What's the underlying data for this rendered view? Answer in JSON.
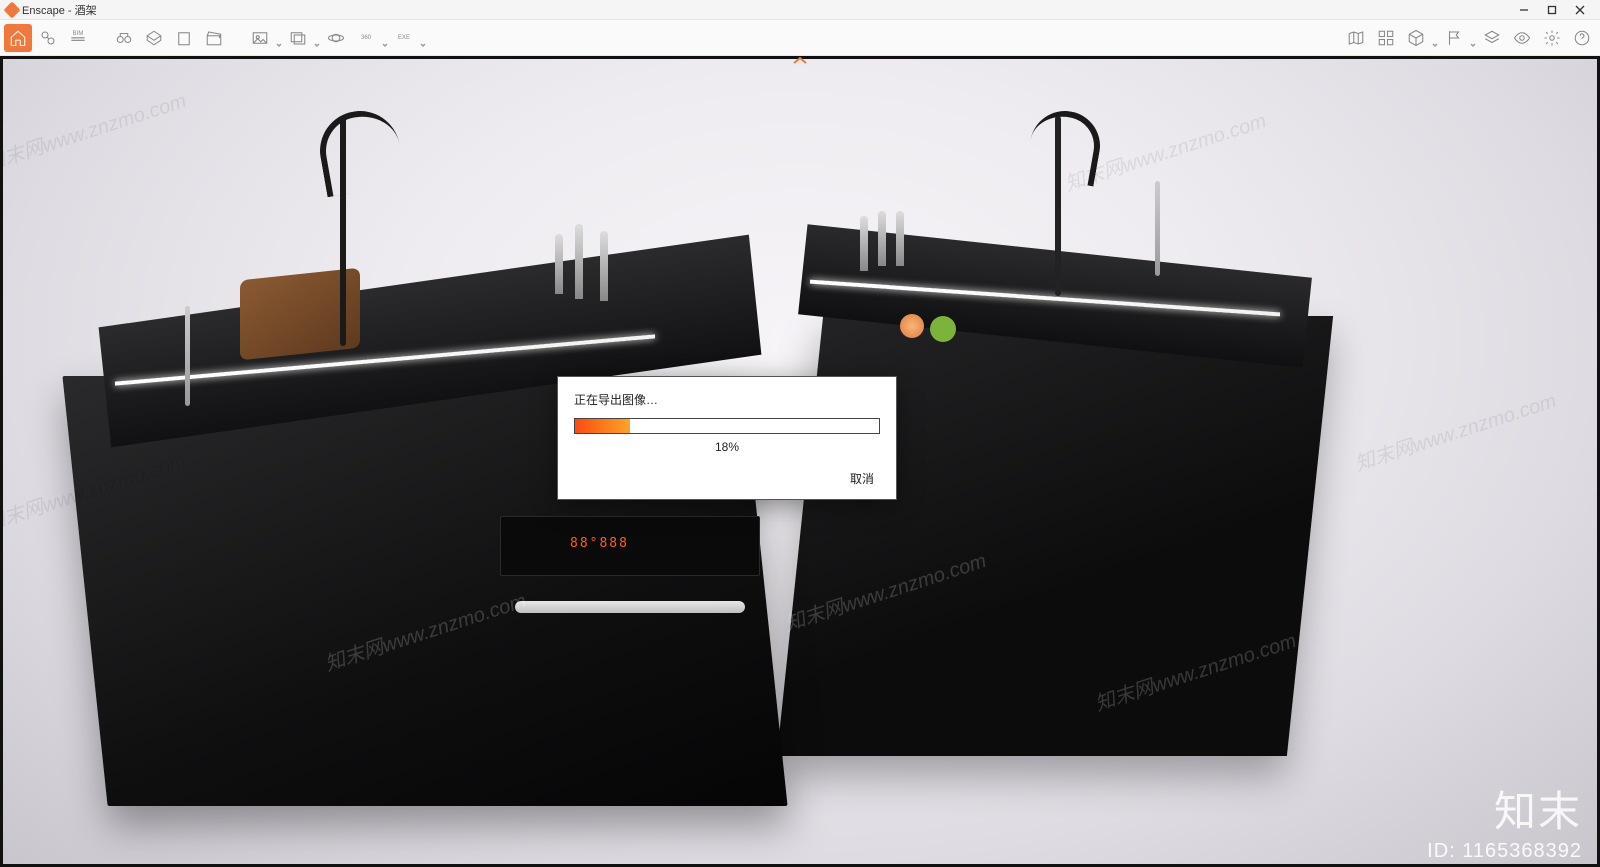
{
  "window": {
    "app_name": "Enscape",
    "document_name": "酒架",
    "title_separator": " - "
  },
  "toolbar": {
    "left_icons": [
      "home-icon",
      "link-icon",
      "bim-icon",
      "binoculars-icon",
      "perspective-icon",
      "building-icon",
      "clapper-icon",
      "export-image-icon",
      "export-batch-icon",
      "orbit-icon",
      "pano-360-icon",
      "exe-export-icon"
    ],
    "right_icons": [
      "map-icon",
      "assets-icon",
      "cube-icon",
      "flag-icon",
      "layers-icon",
      "eye-icon",
      "gear-icon",
      "help-icon"
    ],
    "bim_label": "BIM",
    "pano_label": "360",
    "exe_label": "EXE"
  },
  "dialog": {
    "title": "正在导出图像…",
    "percent_text": "18%",
    "percent_value": 18,
    "cancel_label": "取消"
  },
  "scene": {
    "digital_display": "88°888"
  },
  "watermark": {
    "text": "知末网www.znzmo.com",
    "brand": "知末",
    "id_label": "ID: 1165368392"
  }
}
